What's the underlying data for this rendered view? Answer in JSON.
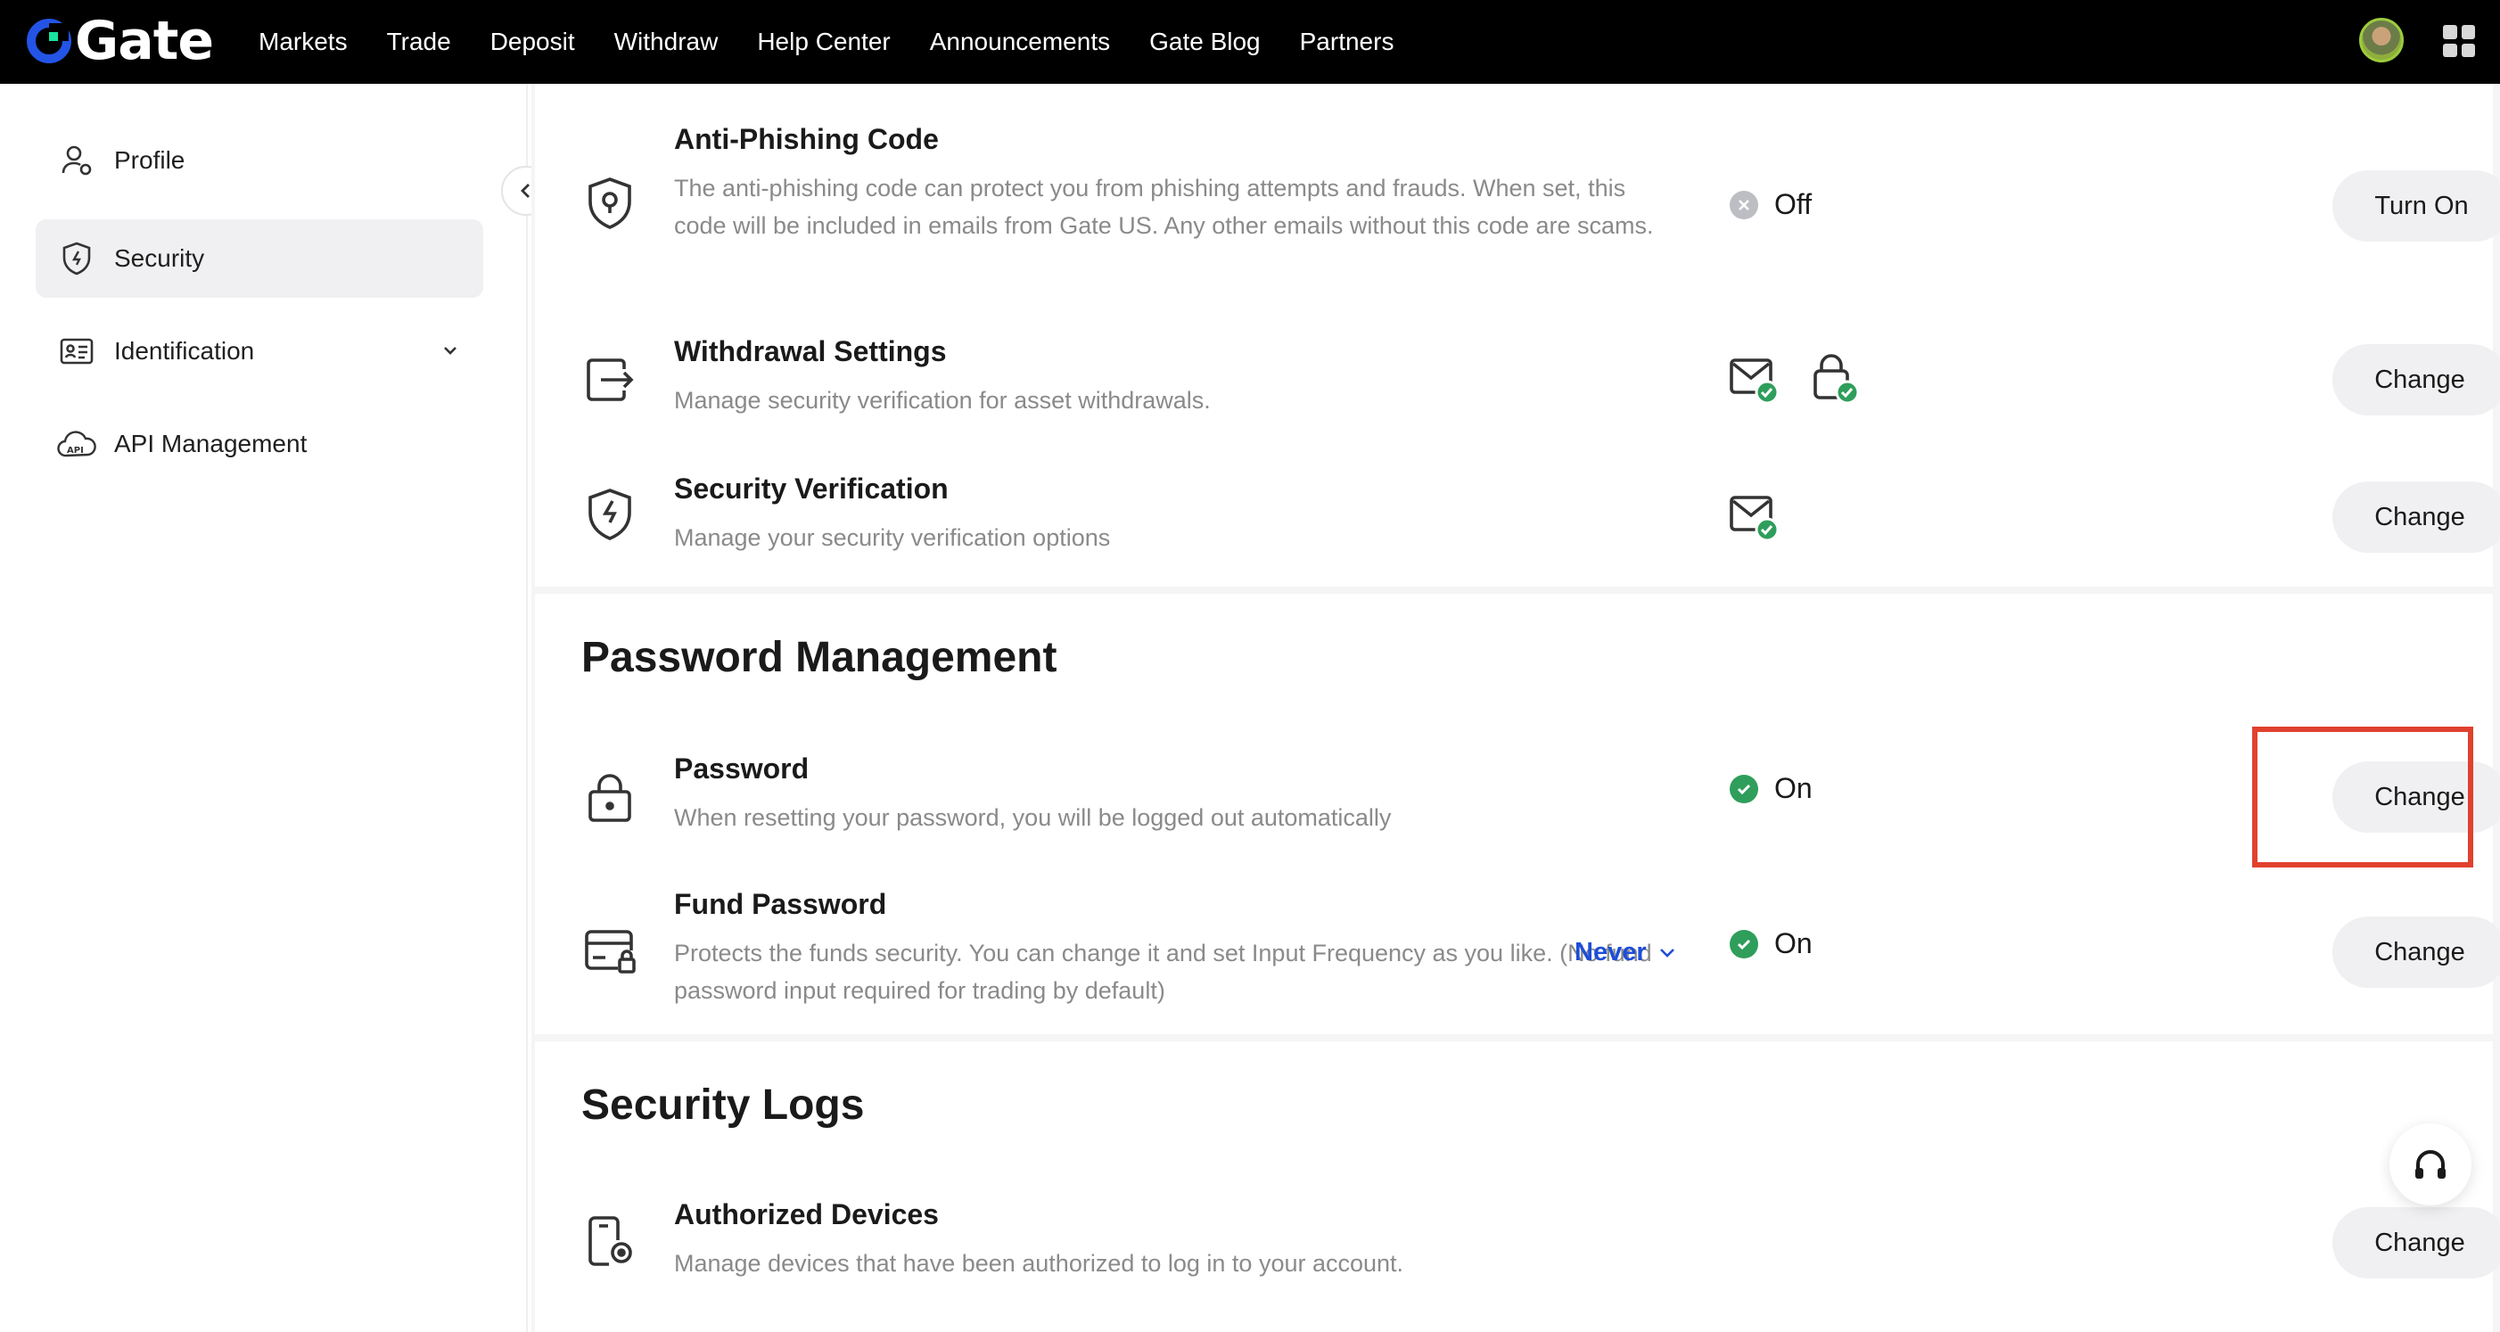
{
  "topbar": {
    "logo_text": "Gate",
    "nav": [
      "Markets",
      "Trade",
      "Deposit",
      "Withdraw",
      "Help Center",
      "Announcements",
      "Gate Blog",
      "Partners"
    ]
  },
  "sidebar": {
    "items": [
      {
        "label": "Profile",
        "icon": "user-icon"
      },
      {
        "label": "Security",
        "icon": "shield-icon",
        "active": true
      },
      {
        "label": "Identification",
        "icon": "id-card-icon"
      },
      {
        "label": "API Management",
        "icon": "api-cloud-icon"
      }
    ]
  },
  "security": {
    "anti_phishing": {
      "title": "Anti-Phishing Code",
      "desc": "The anti-phishing code can protect you from phishing attempts and frauds. When set, this code will be included in emails from Gate US. Any other emails without this code are scams.",
      "status": "Off",
      "button": "Turn On"
    },
    "withdrawal": {
      "title": "Withdrawal Settings",
      "desc": "Manage security verification for asset withdrawals.",
      "button": "Change"
    },
    "verification": {
      "title": "Security Verification",
      "desc": "Manage your security verification options",
      "button": "Change"
    }
  },
  "password_management": {
    "title": "Password Management",
    "password": {
      "title": "Password",
      "desc": "When resetting your password, you will be logged out automatically",
      "status": "On",
      "button": "Change"
    },
    "fund_password": {
      "title": "Fund Password",
      "desc": "Protects the funds security. You can change it and set Input Frequency as you like. (No fund password input required for trading by default)",
      "status": "On",
      "frequency": "Never",
      "button": "Change"
    }
  },
  "security_logs": {
    "title": "Security Logs",
    "devices": {
      "title": "Authorized Devices",
      "desc": "Manage devices that have been authorized to log in to your account.",
      "button": "Change"
    }
  },
  "colors": {
    "accent_blue": "#1d4ed8",
    "status_on": "#2f9e5b",
    "highlight": "#e0412e"
  }
}
